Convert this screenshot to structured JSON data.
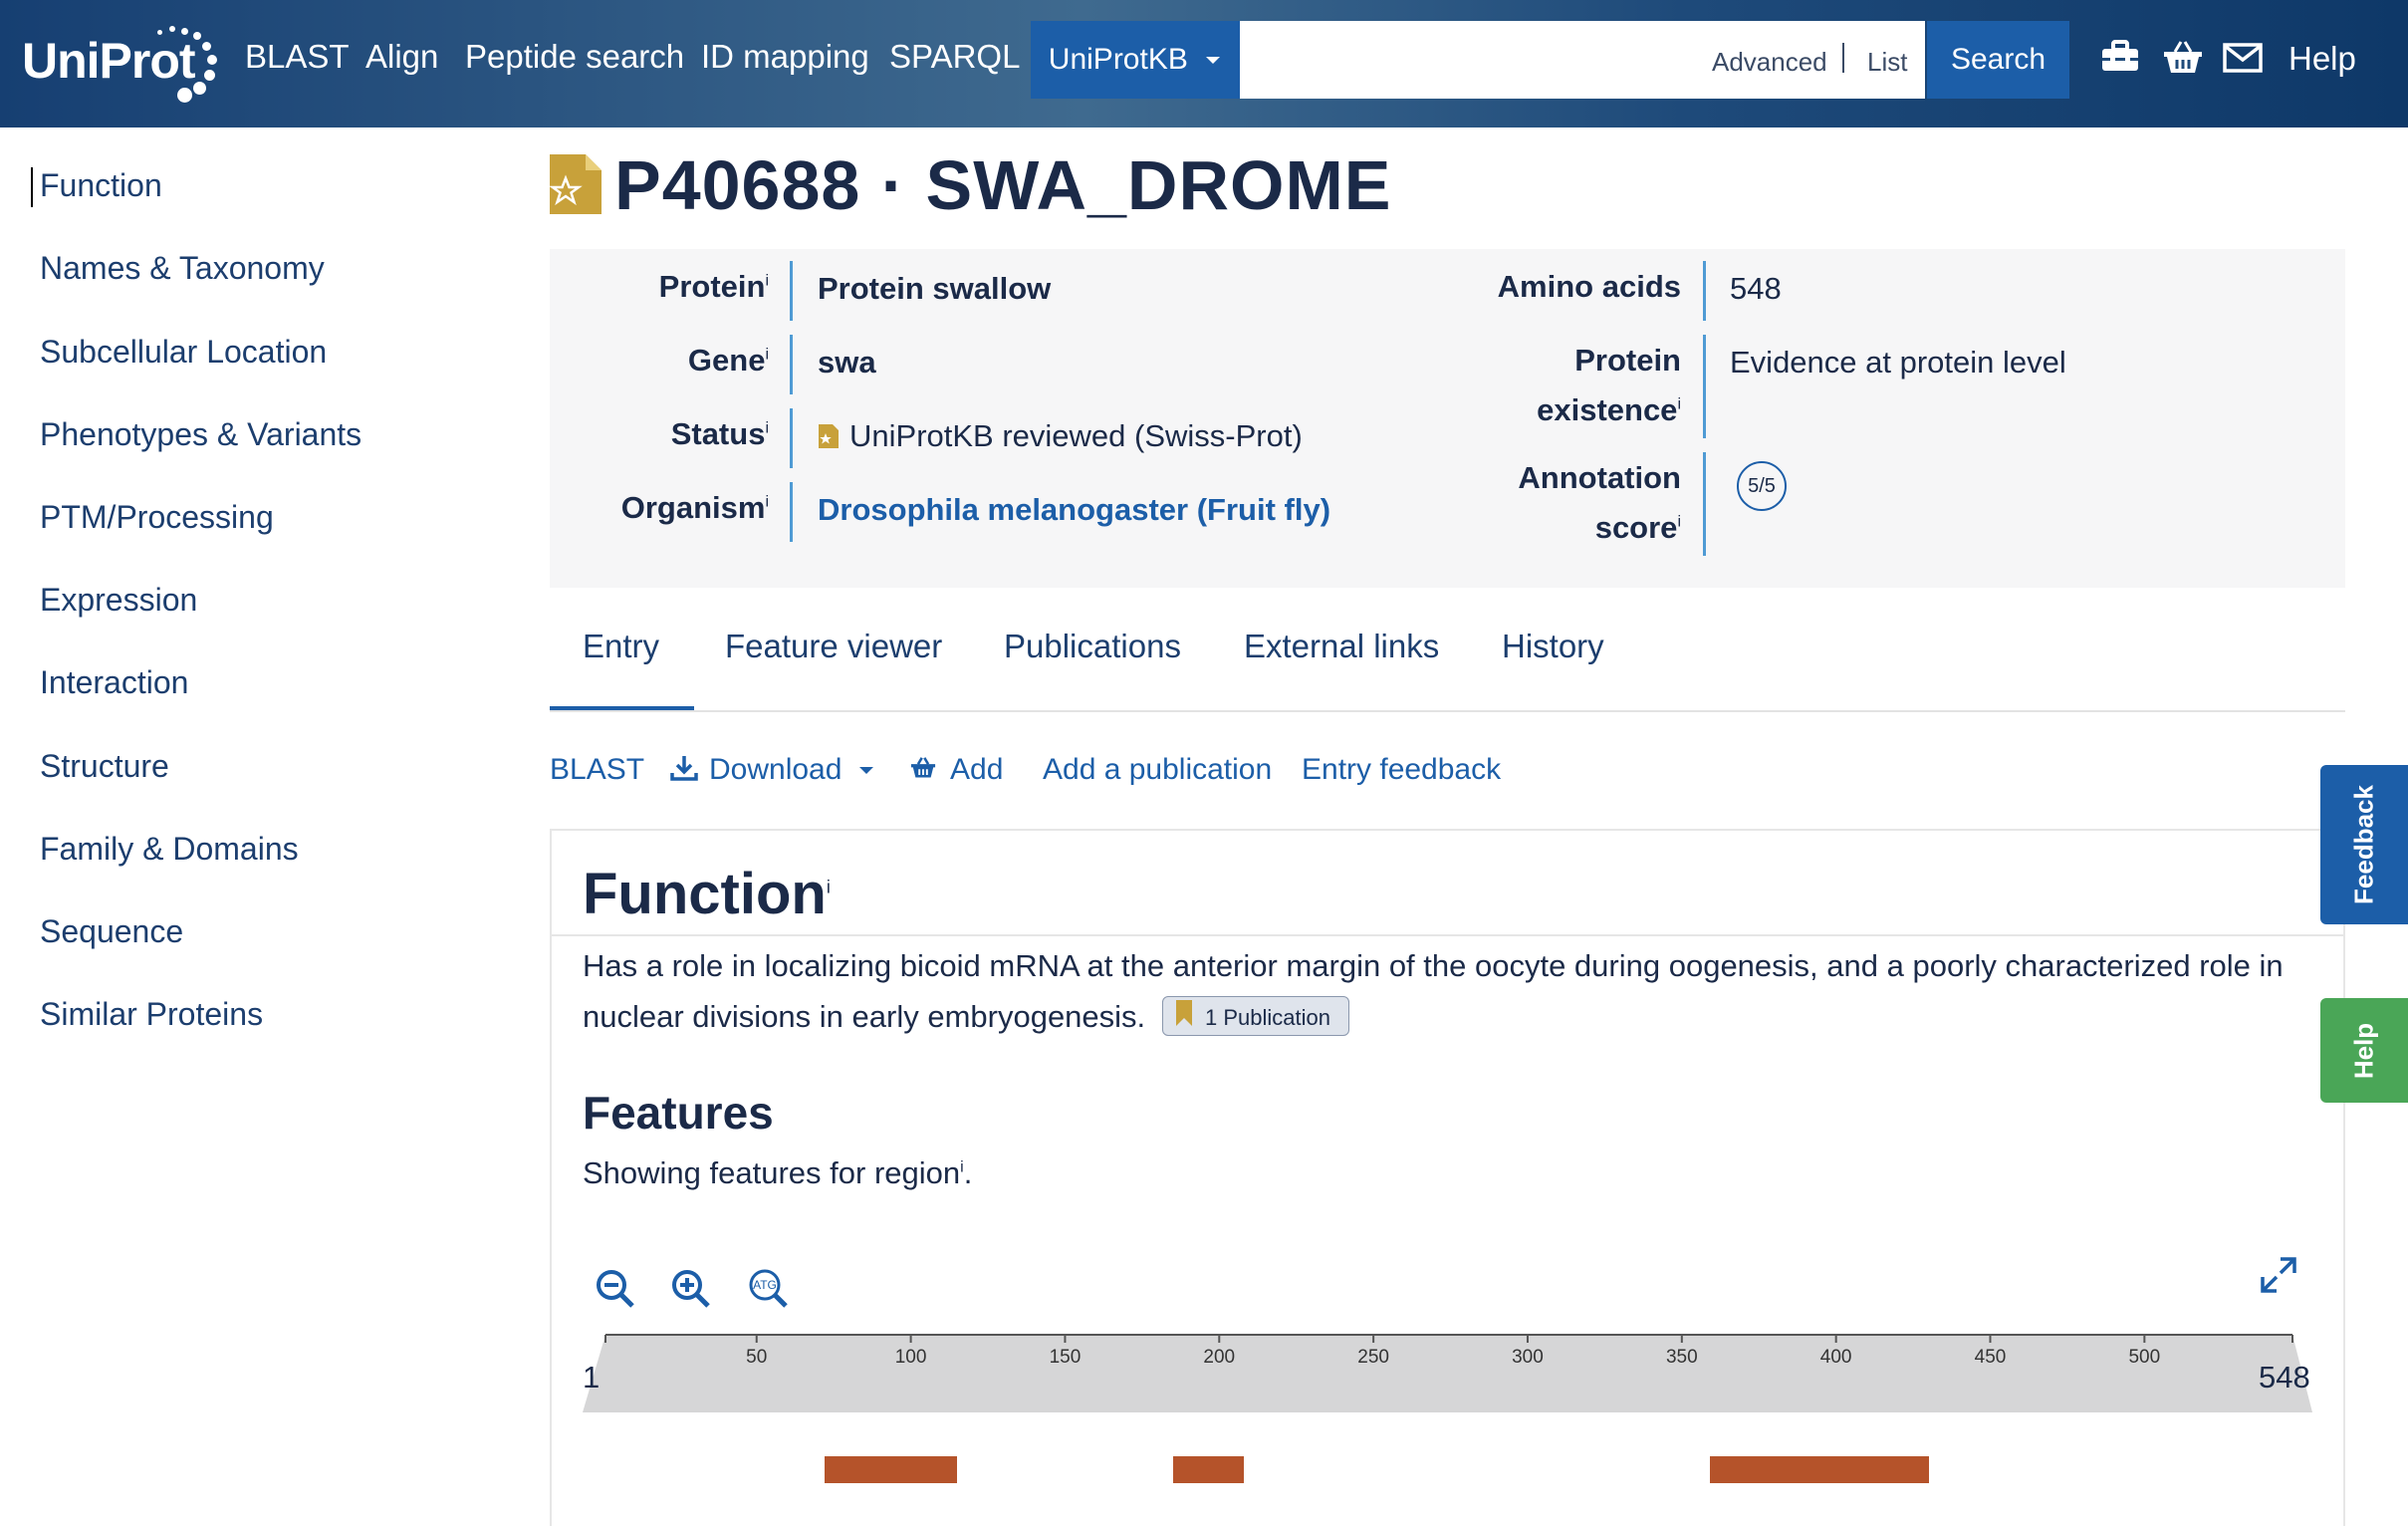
{
  "header": {
    "logo_text": "UniProt",
    "nav": [
      "BLAST",
      "Align",
      "Peptide search",
      "ID mapping",
      "SPARQL"
    ],
    "database_select": "UniProtKB",
    "search_value": "",
    "advanced_label": "Advanced",
    "list_label": "List",
    "search_button": "Search",
    "icons": [
      "toolkit-icon",
      "basket-icon",
      "envelope-icon"
    ],
    "help_label": "Help"
  },
  "sidebar": {
    "items": [
      "Function",
      "Names & Taxonomy",
      "Subcellular Location",
      "Phenotypes & Variants",
      "PTM/Processing",
      "Expression",
      "Interaction",
      "Structure",
      "Family & Domains",
      "Sequence",
      "Similar Proteins"
    ]
  },
  "entry": {
    "title": "P40688 · SWA_DROME",
    "reviewed_icon": "reviewed-document-icon",
    "summary_left": [
      {
        "label": "Protein",
        "value": "Protein swallow"
      },
      {
        "label": "Gene",
        "value": "swa"
      },
      {
        "label": "Status",
        "value": "UniProtKB reviewed (Swiss-Prot)"
      },
      {
        "label": "Organism",
        "value": "Drosophila melanogaster (Fruit fly)"
      }
    ],
    "summary_right": {
      "amino_acids_label": "Amino acids",
      "amino_acids_value": "548",
      "existence_label_1": "Protein",
      "existence_label_2": "existence",
      "existence_value": "Evidence at protein level",
      "annotation_label_1": "Annotation",
      "annotation_label_2": "score",
      "annotation_value": "5/5"
    },
    "info_marker": "i"
  },
  "tabs": [
    "Entry",
    "Feature viewer",
    "Publications",
    "External links",
    "History"
  ],
  "active_tab": "Entry",
  "toolbar": {
    "blast": "BLAST",
    "download": "Download",
    "add": "Add",
    "add_publication": "Add a publication",
    "entry_feedback": "Entry feedback"
  },
  "function_section": {
    "title": "Function",
    "text_line1": "Has a role in localizing bicoid mRNA at the anterior margin of the oocyte during oogenesis, and a poorly characterized role in",
    "text_line2": "nuclear divisions in early embryogenesis.",
    "publication_badge": "1 Publication"
  },
  "features_section": {
    "title": "Features",
    "subtitle_prefix": "Showing features for region",
    "subtitle_suffix": ".",
    "viewer_icons": [
      "zoom-out-icon",
      "zoom-in-icon",
      "sequence-zoom-icon",
      "fullscreen-icon"
    ],
    "ruler_start": "1",
    "ruler_end": "548",
    "ruler_length": 548,
    "ticks": [
      50,
      100,
      150,
      200,
      250,
      300,
      350,
      400,
      450,
      500
    ],
    "features": [
      {
        "start": 72,
        "end": 115
      },
      {
        "start": 185,
        "end": 208
      },
      {
        "start": 359,
        "end": 430
      }
    ],
    "feature_color": "#b5532a"
  },
  "side_tabs": {
    "feedback": "Feedback",
    "help": "Help",
    "feedback_color": "#1c5ea8",
    "help_color": "#4aa657"
  }
}
